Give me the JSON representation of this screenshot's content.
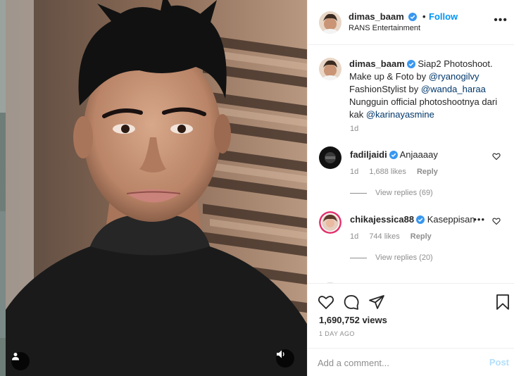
{
  "header": {
    "username": "dimas_baam",
    "separator": "•",
    "follow_label": "Follow",
    "subtitle": "RANS Entertainment",
    "more_glyph": "•••"
  },
  "caption": {
    "username": "dimas_baam",
    "text_1": "Siap2 Photoshoot. Make up & Foto by ",
    "mention_1": "@ryanogilvy",
    "text_2": " FashionStylist by ",
    "mention_2": "@wanda_haraa",
    "text_3": " Nungguin official photoshootnya dari kak ",
    "mention_3": "@karinayasmine",
    "time": "1d"
  },
  "comments": [
    {
      "username": "fadiljaidi",
      "text": "Anjaaaay",
      "time": "1d",
      "likes": "1,688 likes",
      "reply_label": "Reply",
      "view_replies": "View replies (69)"
    },
    {
      "username": "chikajessica88",
      "text": "Kaseppisan",
      "time": "1d",
      "likes": "744 likes",
      "reply_label": "Reply",
      "view_replies": "View replies (20)",
      "more_glyph": "•••"
    }
  ],
  "stats": {
    "views": "1,690,752 views",
    "date": "1 DAY AGO"
  },
  "add_comment": {
    "placeholder": "Add a comment...",
    "post_label": "Post"
  },
  "colors": {
    "link_blue": "#0095f6",
    "mention": "#00376b",
    "verified": "#3897f0",
    "muted": "#8e8e8e",
    "post_disabled": "#b2dffc"
  },
  "icons": {
    "verified": "verified-badge-icon",
    "heart": "heart-icon",
    "comment": "comment-icon",
    "share": "share-icon",
    "bookmark": "bookmark-icon",
    "user_tag": "user-tag-icon",
    "audio": "audio-icon"
  }
}
